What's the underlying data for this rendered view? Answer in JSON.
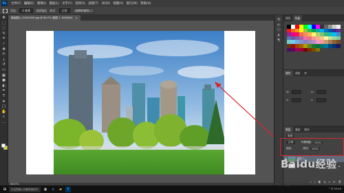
{
  "app": {
    "logo": "Ps"
  },
  "menu": [
    "文件(F)",
    "编辑(E)",
    "图像(I)",
    "图层(L)",
    "文字(Y)",
    "选择(S)",
    "滤镜(T)",
    "3D(D)",
    "视图(V)",
    "窗口(W)",
    "帮助(H)"
  ],
  "options": {
    "feather_label": "羽化:",
    "feather_value": "0 像素",
    "antialias_label": "消除锯齿",
    "style_label": "样式:",
    "style_value": "正常",
    "select_btn": "选择并遮住..."
  },
  "document_tab": {
    "title": "微信图片_20200429.jpg @ 66.7% (图层 1, RGB/8#)",
    "close": "×"
  },
  "status": {
    "zoom": "66.67%"
  },
  "panel": {
    "tabs": [
      "颜色",
      "色板"
    ],
    "active_tab": "色板",
    "adjust_tabs": [
      "属性",
      "调整",
      "库"
    ],
    "adjust_fields": [
      "W:",
      "H:",
      "X:",
      "Y:"
    ]
  },
  "layers_panel": {
    "tabs": [
      "图层",
      "通道",
      "路径"
    ],
    "active_tab": "图层",
    "kind_label": "类型",
    "blend_mode": "正常",
    "opacity_label": "不透明度:",
    "opacity_value": "100%",
    "lock_label": "锁定:",
    "fill_label": "填充:",
    "fill_value": "100%",
    "layers": [
      {
        "name": "图层 1",
        "selected": true
      },
      {
        "name": "背景",
        "selected": false,
        "locked": true
      }
    ]
  },
  "taskbar": {
    "search_placeholder": "在这里输入你要搜索的内容",
    "tray": "^ 中 20:44"
  },
  "watermark": {
    "brand": "Baidu经验",
    "url": "jingyan.baidu.com"
  },
  "colors": {
    "highlight": "#d9252a",
    "sky": "#4a86c8",
    "grass": "#4e9a2c"
  },
  "swatches": [
    "#000000",
    "#ffffff",
    "#ff0000",
    "#ffff00",
    "#00ff00",
    "#00ffff",
    "#0000ff",
    "#ff00ff",
    "#333333",
    "#666666",
    "#999999",
    "#cccccc",
    "#eeeeee",
    "#ed1c24",
    "#f26522",
    "#f7941d",
    "#fff200",
    "#8dc63f",
    "#39b54a",
    "#00a651",
    "#00a99d",
    "#00aeef",
    "#0072bc",
    "#0054a6",
    "#2e3192",
    "#662d91",
    "#92278f",
    "#ec008c",
    "#ed145b",
    "#f26c4f",
    "#f68e56",
    "#fbaf5d",
    "#fff568",
    "#acd373",
    "#7cc576",
    "#3bb878",
    "#1abbb4",
    "#00bff3",
    "#448ccb",
    "#5574b9",
    "#605ca8",
    "#855fa8",
    "#a763a8",
    "#f06eaa",
    "#f26d7d",
    "#f5989d",
    "#f9ad81",
    "#fdc68a",
    "#fff799",
    "#c4df9b",
    "#a3d39c",
    "#82ca9d",
    "#7accc8",
    "#6dcff6",
    "#7da7d9",
    "#8393ca",
    "#8781bd",
    "#a186be",
    "#bd8cbf",
    "#f49ac2",
    "#f6989d",
    "#c69c6d",
    "#a67c52",
    "#8c6239",
    "#754c24",
    "#603913",
    "#9e0b0f",
    "#a0410d",
    "#a3620a",
    "#aba000",
    "#598527",
    "#197b30",
    "#007236",
    "#00746b",
    "#0076a3",
    "#004b80",
    "#003471",
    "#1b1464",
    "#440e62",
    "#630460",
    "#9e005d",
    "#9e0039",
    "#790000",
    "#7b2e00",
    "#7d4900",
    "#827b00"
  ]
}
